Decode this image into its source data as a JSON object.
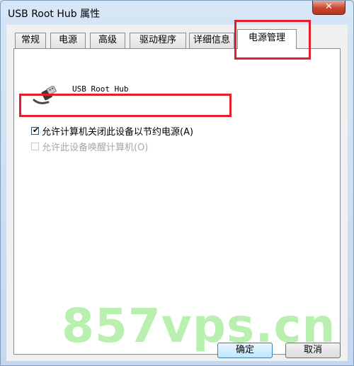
{
  "window": {
    "title": "USB Root Hub 属性",
    "close_label": "✕"
  },
  "tabs": [
    {
      "label": "常规"
    },
    {
      "label": "电源"
    },
    {
      "label": "高级"
    },
    {
      "label": "驱动程序"
    },
    {
      "label": "详细信息"
    },
    {
      "label": "电源管理",
      "active": true
    }
  ],
  "device": {
    "icon": "usb-plug-icon",
    "name": "USB Root Hub"
  },
  "options": [
    {
      "label": "允许计算机关闭此设备以节约电源(A)",
      "checked": true,
      "enabled": true
    },
    {
      "label": "允许此设备唤醒计算机(O)",
      "checked": false,
      "enabled": false
    }
  ],
  "buttons": {
    "ok_label": "确定",
    "cancel_label": "取消"
  },
  "watermark": "857vps.cn",
  "colors": {
    "highlight": "#e0202c",
    "watermark": "#82e46e",
    "panel_bg": "#ffffff",
    "dialog_bg": "#f0f0f0"
  }
}
